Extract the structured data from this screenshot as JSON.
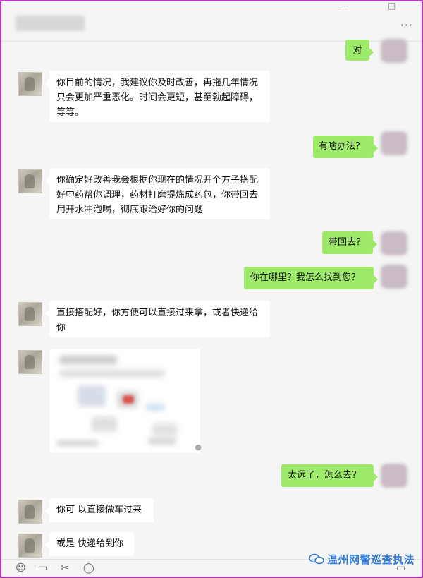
{
  "window": {
    "minimize_glyph": "—",
    "maximize_glyph": "□",
    "more_glyph": "···",
    "icons": [
      "pin-icon",
      "minimize-icon",
      "maximize-icon",
      "more-icon"
    ]
  },
  "messages": [
    {
      "side": "out",
      "text": "对"
    },
    {
      "side": "in",
      "text": "你目前的情况，我建议你及时改善，再拖几年情况只会更加严重恶化。时间会更短，甚至勃起障碍，等等。"
    },
    {
      "side": "out",
      "text": "有啥办法？"
    },
    {
      "side": "in",
      "text": "你确定好改善我会根据你现在的情况开个方子搭配好中药帮你调理，药材打磨提炼成药包，你带回去用开水冲泡喝，彻底跟治好你的问题"
    },
    {
      "side": "out",
      "text": "带回去？"
    },
    {
      "side": "out",
      "text": "你在哪里？我怎么找到您？"
    },
    {
      "side": "in",
      "text": "直接搭配好，你方便可以直接过来拿，或者快递给你"
    },
    {
      "side": "in",
      "type": "location-card"
    },
    {
      "side": "out",
      "text": "太远了，怎么去？"
    },
    {
      "side": "in",
      "text": "你可 以直接做车过来"
    },
    {
      "side": "in",
      "text": "或是 快递给到你"
    }
  ],
  "watermark": {
    "text": "温州网警巡查执法",
    "icon": "wechat-icon"
  },
  "colors": {
    "frame": "#b03ab8",
    "outgoing_bubble": "#9eea6a",
    "incoming_bubble": "#ffffff",
    "background": "#f5f5f5"
  }
}
